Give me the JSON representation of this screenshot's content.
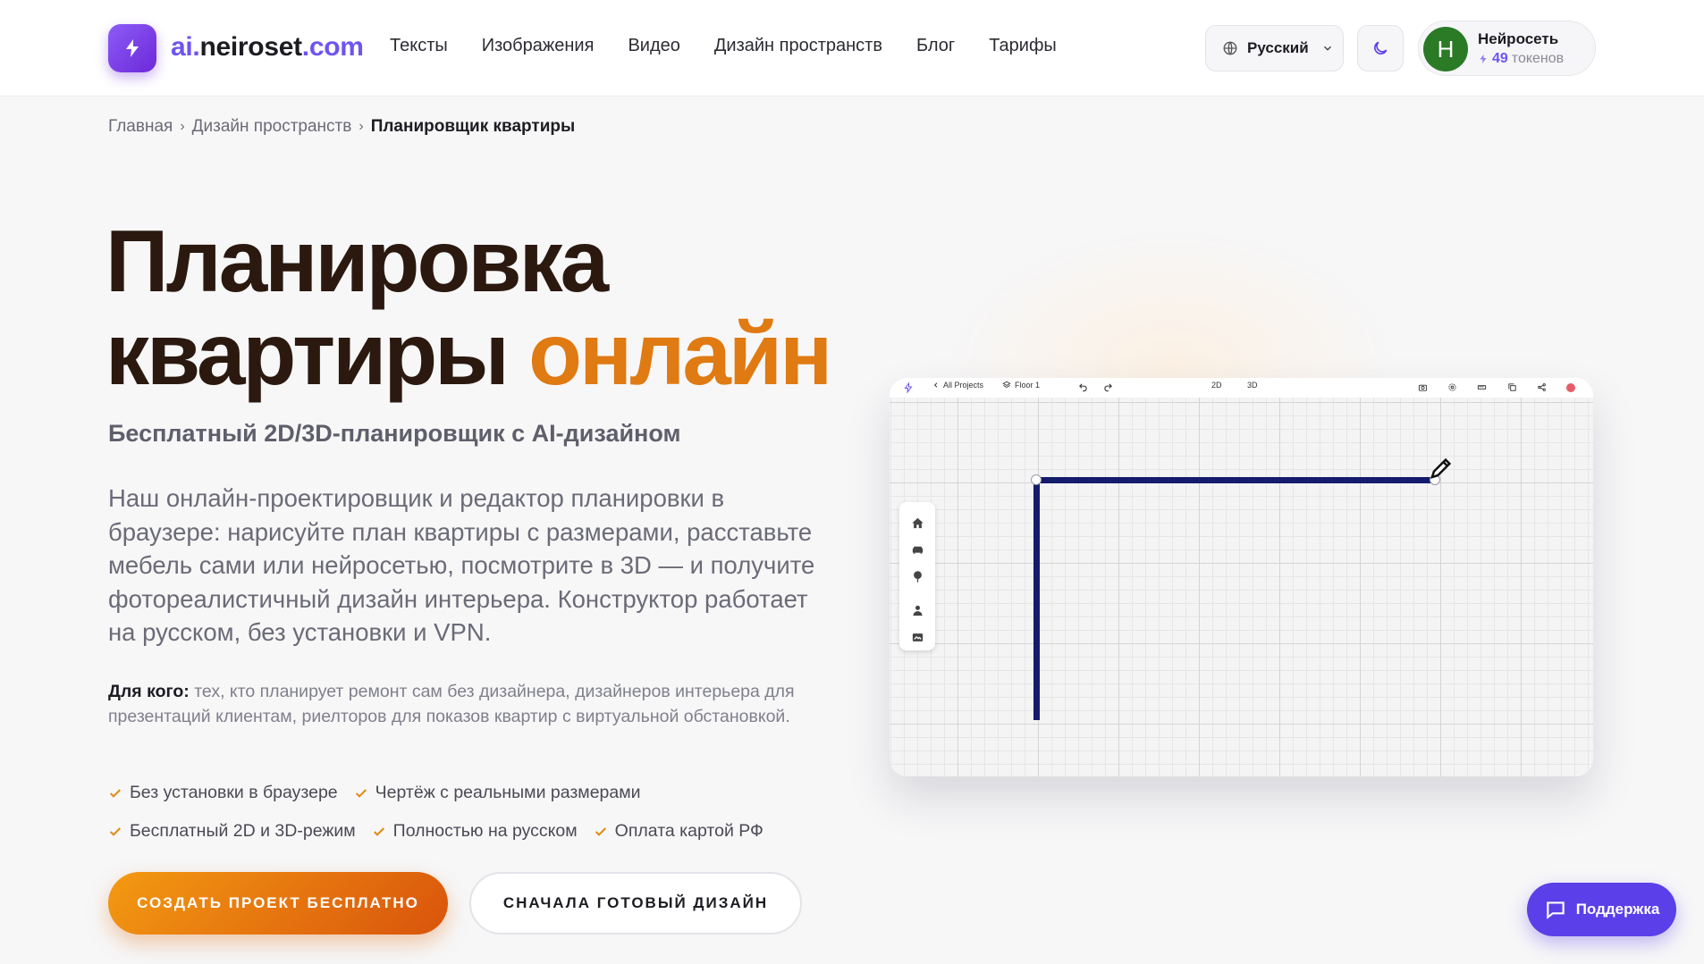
{
  "header": {
    "logo_part1": "ai.",
    "logo_part2": "neiroset",
    "logo_part3": ".com",
    "logo_icon": "lightning-icon",
    "nav": [
      "Тексты",
      "Изображения",
      "Видео",
      "Дизайн пространств",
      "Блог",
      "Тарифы"
    ],
    "language": "Русский",
    "theme_icon": "moon-icon",
    "user": {
      "avatar_letter": "Н",
      "name": "Нейросеть",
      "tokens": "49",
      "tokens_label": "токенов"
    }
  },
  "breadcrumb": {
    "home": "Главная",
    "section": "Дизайн пространств",
    "current": "Планировщик квартиры"
  },
  "hero": {
    "title_line1": "Планировка",
    "title_line2": "квартиры",
    "title_accent": "онлайн",
    "subtitle": "Бесплатный 2D/3D-планировщик с AI-дизайном",
    "description": "Наш онлайн-проектировщик и редактор планировки в браузере: нарисуйте план квартиры с размерами, расставьте мебель сами или нейросетью, посмотрите в 3D — и получите фотореалистичный дизайн интерьера. Конструктор работает на русском, без установки и VPN.",
    "for_whom_label": "Для кого:",
    "for_whom_text": "тех, кто планирует ремонт сам без дизайнера, дизайнеров интерьера для презентаций клиентам, риелторов для показов квартир с виртуальной обстановкой.",
    "features": [
      "Без установки в браузере",
      "Чертёж с реальными размерами",
      "Бесплатный 2D и 3D-режим",
      "Полностью на русском",
      "Оплата картой РФ"
    ],
    "primary_button": "СОЗДАТЬ ПРОЕКТ БЕСПЛАТНО",
    "secondary_button": "СНАЧАЛА ГОТОВЫЙ ДИЗАЙН"
  },
  "planner": {
    "back_label": "All Projects",
    "floor_label": "Floor 1",
    "mode_2d": "2D",
    "mode_3d": "3D",
    "toolbar_icons": [
      "undo-icon",
      "redo-icon",
      "camera-icon",
      "settings-icon",
      "ruler-icon",
      "copy-icon",
      "share-icon"
    ],
    "side_tools": [
      "home-icon",
      "sofa-icon",
      "tree-icon",
      "person-icon",
      "layers-icon"
    ]
  },
  "support": {
    "label": "Поддержка",
    "icon": "chat-icon"
  },
  "colors": {
    "brand": "#6d55f0",
    "accent": "#e07a12",
    "title": "#2b190f",
    "wall": "#141c6b"
  }
}
